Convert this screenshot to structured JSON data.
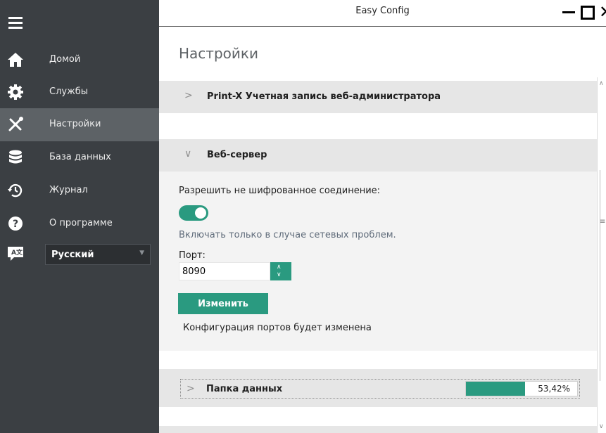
{
  "window": {
    "title": "Easy Config"
  },
  "sidebar": {
    "items": [
      {
        "label": "Домой",
        "icon": "home-icon"
      },
      {
        "label": "Службы",
        "icon": "gear-icon"
      },
      {
        "label": "Настройки",
        "icon": "tools-icon",
        "active": true
      },
      {
        "label": "База данных",
        "icon": "database-icon"
      },
      {
        "label": "Журнал",
        "icon": "history-icon"
      },
      {
        "label": "О программе",
        "icon": "help-icon"
      }
    ],
    "language": {
      "icon": "language-icon",
      "selected": "Русский"
    }
  },
  "main": {
    "page_title": "Настройки",
    "sections": {
      "admin_account": {
        "label": "Print-X Учетная запись веб-администратора",
        "expanded": false
      },
      "web_server": {
        "label": "Веб-сервер",
        "expanded": true,
        "unencrypted_label": "Разрешить не шифрованное соединение:",
        "unencrypted_enabled": true,
        "hint": "Включать только в случае сетевых проблем.",
        "port_label": "Порт:",
        "port_value": "8090",
        "change_button": "Изменить",
        "status_text": "Конфигурация портов будет изменена"
      },
      "data_folder": {
        "label": "Папка данных",
        "expanded": false,
        "progress_text": "53,42%",
        "progress": 0.5342
      }
    }
  },
  "colors": {
    "accent": "#2a9a80",
    "sidebar_bg": "#3b3f43",
    "sidebar_active": "#5d6266"
  }
}
